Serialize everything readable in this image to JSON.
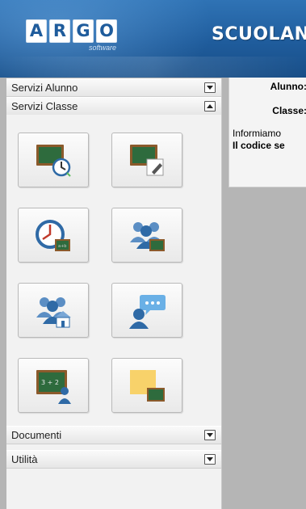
{
  "header": {
    "logo_letters": [
      "A",
      "R",
      "G",
      "O"
    ],
    "logo_sub": "software",
    "app_title": "SCUOLANE"
  },
  "sidebar": {
    "sections": {
      "servizi_alunno": "Servizi Alunno",
      "servizi_classe": "Servizi Classe",
      "documenti": "Documenti",
      "utilita": "Utilità"
    },
    "tiles": [
      "clock-chalkboard-icon",
      "chalkboard-pencil-icon",
      "clock-small-board-icon",
      "group-chalkboard-icon",
      "group-school-icon",
      "person-chat-icon",
      "chalkboard-math-icon",
      "sticky-note-board-icon"
    ]
  },
  "info": {
    "alunno_label": "Alunno:",
    "classe_label": "Classe:",
    "message_line1": "Informiamo",
    "message_line2": "Il codice se"
  },
  "colors": {
    "header_blue": "#1f5c9c",
    "chalkboard_green": "#2e6b3d",
    "frame_brown": "#8b5a2b",
    "icon_blue": "#2f6aa6"
  }
}
